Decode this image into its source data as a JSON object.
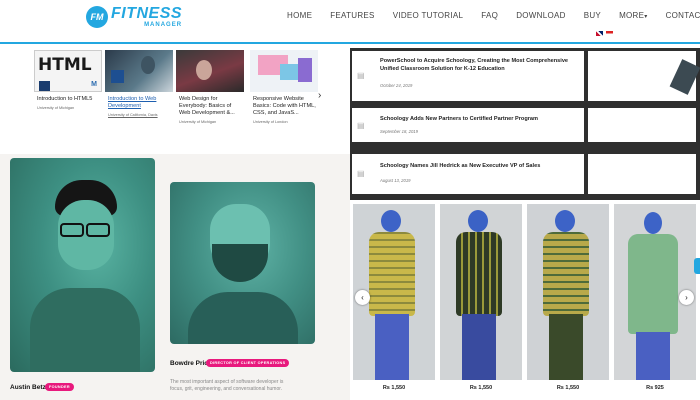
{
  "header": {
    "logo_mark": "FM",
    "logo_main": "FITNESS",
    "logo_sub": "MANAGER",
    "nav": [
      "HOME",
      "FEATURES",
      "VIDEO TUTORIAL",
      "FAQ",
      "DOWNLOAD",
      "BUY",
      "MORE",
      "CONTACT"
    ]
  },
  "courses": [
    {
      "thumb_text": "HTML",
      "title": "Introduction to HTML5",
      "provider": "University of Michigan"
    },
    {
      "thumb_text": "",
      "title": "Introduction to Web Development",
      "provider": "University of California, Davis"
    },
    {
      "thumb_text": "",
      "title": "Web Design for Everybody: Basics of Web Development &...",
      "provider": "University of Michigan"
    },
    {
      "thumb_text": "",
      "title": "Responsive Website Basics: Code with HTML, CSS, and JavaS...",
      "provider": "University of London"
    }
  ],
  "team": [
    {
      "name": "Austin Betzer",
      "role": "FOUNDER"
    },
    {
      "name": "Bowdre Price",
      "role": "DIRECTOR OF CLIENT OPERATIONS",
      "bio": "The most important aspect of software developer is focus, grit, engineering, and conversational humor."
    }
  ],
  "news": [
    {
      "title": "PowerSchool to Acquire Schoology, Creating the Most Comprehensive Unified Classroom Solution for K-12 Education",
      "date": "October 24, 2019"
    },
    {
      "title": "Schoology Adds New Partners to Certified Partner Program",
      "date": "September 18, 2019"
    },
    {
      "title": "Schoology Names Jill Hedrick as New Executive VP of Sales",
      "date": "August 13, 2019"
    }
  ],
  "products": [
    {
      "price": "Rs 1,550"
    },
    {
      "price": "Rs 1,550"
    },
    {
      "price": "Rs 1,550"
    },
    {
      "price": "Rs 925"
    }
  ],
  "colors": {
    "accent": "#23a7e0",
    "badge": "#e8197d"
  },
  "icons": {
    "prev": "‹",
    "next": "›"
  }
}
